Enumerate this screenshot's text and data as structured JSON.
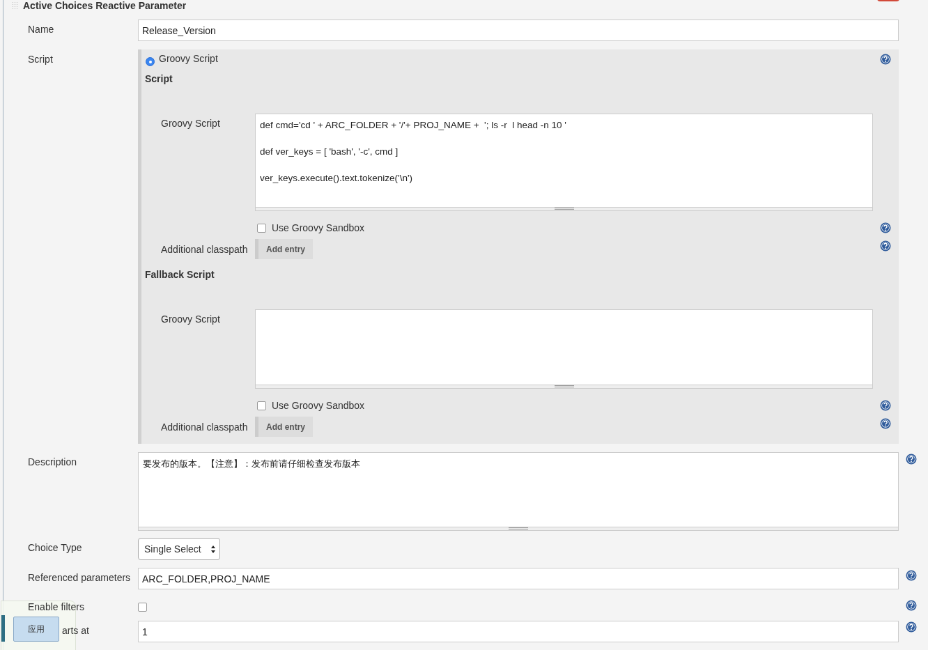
{
  "section": {
    "title": "Active Choices Reactive Parameter"
  },
  "name": {
    "label": "Name",
    "value": "Release_Version"
  },
  "script": {
    "label": "Script",
    "option": {
      "label": "Groovy Script",
      "selected": true
    },
    "blocks": [
      {
        "heading": "Script",
        "editor_label": "Groovy Script",
        "code": "def cmd='cd ' + ARC_FOLDER + '/'+ PROJ_NAME +  '; ls -r  l head -n 10 '\n\ndef ver_keys = [ 'bash', '-c', cmd ]\n\nver_keys.execute().text.tokenize('\\n')",
        "sandbox": {
          "label": "Use Groovy Sandbox",
          "checked": false
        },
        "classpath_label": "Additional classpath",
        "button": "Add entry"
      },
      {
        "heading": "Fallback Script",
        "editor_label": "Groovy Script",
        "sandbox": {
          "label": "Use Groovy Sandbox",
          "checked": false
        },
        "classpath_label": "Additional classpath",
        "button": "Add entry"
      }
    ]
  },
  "description": {
    "label": "Description",
    "value": "要发布的版本。【注意】：发布前请仔细检查发布版本"
  },
  "choice_type": {
    "label": "Choice Type",
    "value": "Single Select"
  },
  "referenced": {
    "label": "Referenced parameters",
    "value": "ARC_FOLDER,PROJ_NAME"
  },
  "enable_filters": {
    "label": "Enable filters",
    "checked": false
  },
  "filter_start": {
    "label": "arts at",
    "value": "1"
  },
  "overlay": {
    "button": "应用"
  }
}
